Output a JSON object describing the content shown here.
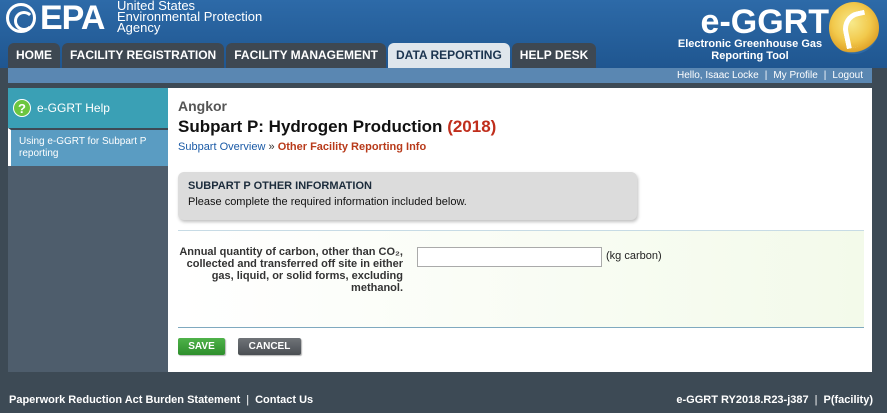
{
  "header": {
    "epa_word": "EPA",
    "agency_lines": [
      "United States",
      "Environmental Protection",
      "Agency"
    ],
    "app_logo": "e-GGRT",
    "app_subtitle_lines": [
      "Electronic Greenhouse Gas",
      "Reporting Tool"
    ]
  },
  "nav": {
    "tabs": [
      {
        "label": "HOME",
        "active": false
      },
      {
        "label": "FACILITY REGISTRATION",
        "active": false
      },
      {
        "label": "FACILITY MANAGEMENT",
        "active": false
      },
      {
        "label": "DATA REPORTING",
        "active": true
      },
      {
        "label": "HELP DESK",
        "active": false
      }
    ]
  },
  "userbar": {
    "greeting": "Hello, Isaac Locke",
    "sep": "|",
    "my_profile": "My Profile",
    "logout": "Logout"
  },
  "sidebar": {
    "help_icon": "?",
    "help_title": "e-GGRT Help",
    "help_link": "Using e-GGRT for Subpart P reporting"
  },
  "main": {
    "facility": "Angkor",
    "title": "Subpart P: Hydrogen Production",
    "year": "(2018)",
    "breadcrumb": {
      "link": "Subpart Overview",
      "separator": "»",
      "current": "Other Facility Reporting Info"
    },
    "info": {
      "title": "SUBPART P OTHER INFORMATION",
      "text": "Please complete the required information included below."
    },
    "form": {
      "field_label": "Annual quantity of carbon, other than CO₂, collected and transferred off site in either gas, liquid, or solid forms, excluding methanol.",
      "field_value": "",
      "unit": "(kg carbon)"
    },
    "buttons": {
      "save": "SAVE",
      "cancel": "CANCEL"
    }
  },
  "footer": {
    "paperwork": "Paperwork Reduction Act Burden Statement",
    "sep": "|",
    "contact": "Contact Us",
    "version": "e-GGRT RY2018.R23-j387",
    "context": "P(facility)"
  },
  "colors": {
    "header_blue": "#2a62a0",
    "active_tab": "#dfe6ec",
    "save_green": "#2e8f2c",
    "title_year_red": "#c02e1c"
  }
}
